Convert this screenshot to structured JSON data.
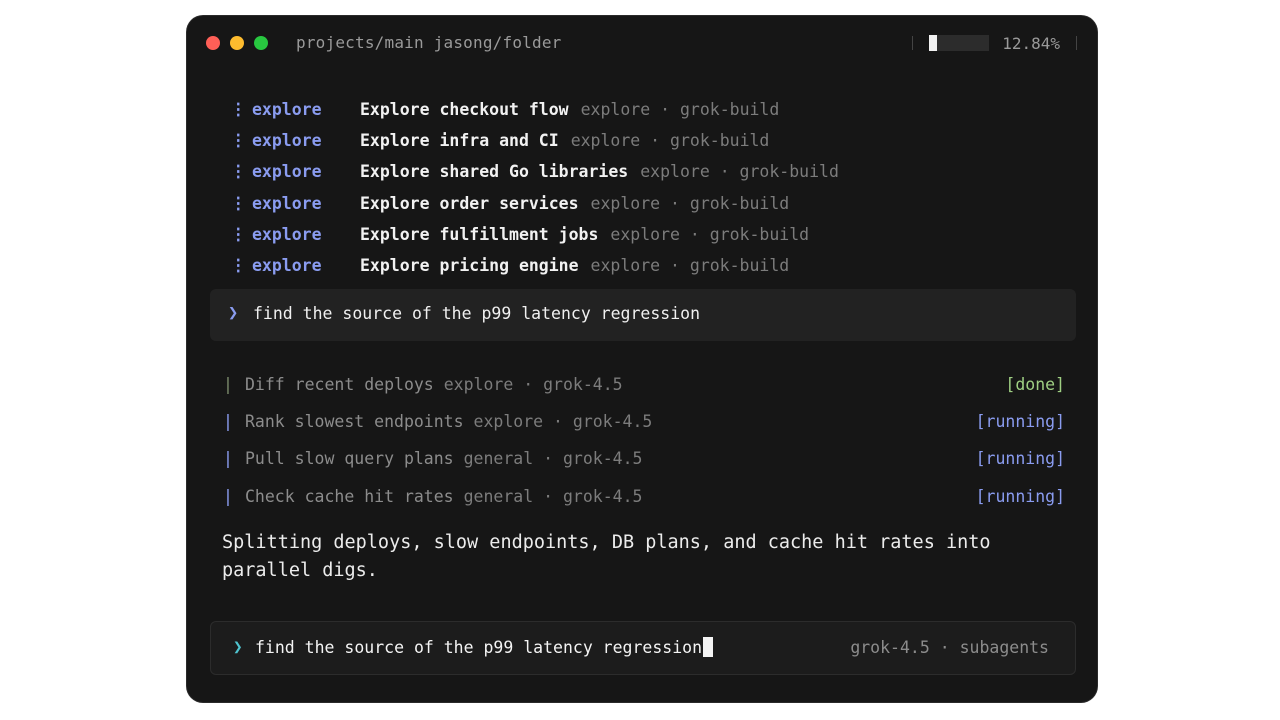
{
  "window": {
    "path": "projects/main jasong/folder",
    "usage_percent_label": "12.84%",
    "usage_fraction": 0.1284
  },
  "agents": [
    {
      "icon": "⋮",
      "type": "explore",
      "title": "Explore checkout flow",
      "meta": "explore · grok-build"
    },
    {
      "icon": "⋮",
      "type": "explore",
      "title": "Explore infra and CI",
      "meta": "explore · grok-build"
    },
    {
      "icon": "⋮",
      "type": "explore",
      "title": "Explore shared Go libraries",
      "meta": "explore · grok-build"
    },
    {
      "icon": "⋮",
      "type": "explore",
      "title": "Explore order services",
      "meta": "explore · grok-build"
    },
    {
      "icon": "⋮",
      "type": "explore",
      "title": "Explore fulfillment jobs",
      "meta": "explore · grok-build"
    },
    {
      "icon": "⋮",
      "type": "explore",
      "title": "Explore pricing engine",
      "meta": "explore · grok-build"
    }
  ],
  "prompt": {
    "chevron": "❯",
    "text": "find the source of the p99 latency regression"
  },
  "tasks": [
    {
      "pipe": "|",
      "label": "Diff recent deploys",
      "meta": "explore · grok-4.5",
      "status": "[done]",
      "state": "done"
    },
    {
      "pipe": "|",
      "label": "Rank slowest endpoints",
      "meta": "explore · grok-4.5",
      "status": "[running]",
      "state": "running"
    },
    {
      "pipe": "|",
      "label": "Pull slow query plans",
      "meta": "general · grok-4.5",
      "status": "[running]",
      "state": "running"
    },
    {
      "pipe": "|",
      "label": "Check cache hit rates",
      "meta": "general · grok-4.5",
      "status": "[running]",
      "state": "running"
    }
  ],
  "summary": "Splitting deploys, slow endpoints, DB plans, and cache hit rates into parallel digs.",
  "input": {
    "chevron": "❯",
    "value": "find the source of the p99 latency regression",
    "model": "grok-4.5 · subagents"
  },
  "colors": {
    "accent": "#8a9cf0",
    "done": "#9fcf83",
    "input_chevron": "#4fc4cf",
    "background": "#161616"
  }
}
